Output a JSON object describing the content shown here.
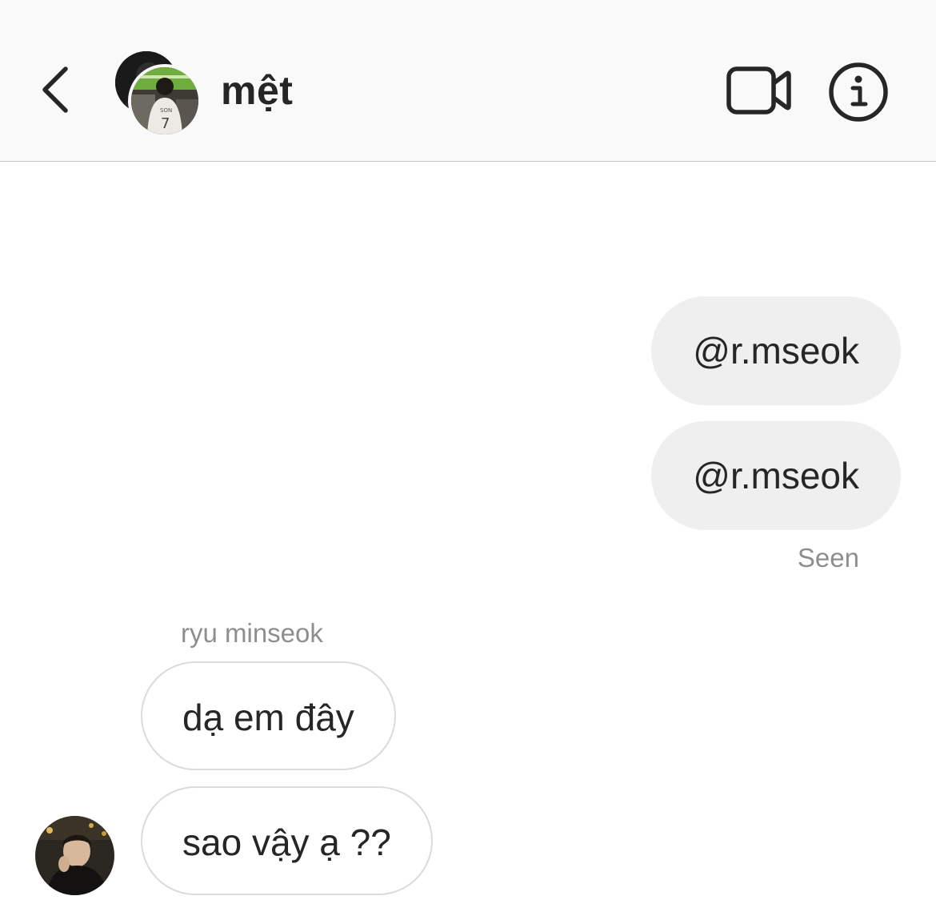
{
  "header": {
    "title": "mệt",
    "back_icon": "chevron-left-icon",
    "video_icon": "video-camera-icon",
    "info_icon": "info-icon"
  },
  "messages": [
    {
      "direction": "out",
      "text": "@r.mseok"
    },
    {
      "direction": "out",
      "text": "@r.mseok"
    },
    {
      "direction": "in",
      "text": "dạ em đây"
    },
    {
      "direction": "in",
      "text": "sao vậy ạ ??"
    }
  ],
  "read_receipt": "Seen",
  "sender": {
    "name": "ryu minseok"
  },
  "colors": {
    "header_bg": "#f9f9f9",
    "outgoing_bubble": "#efefef",
    "incoming_border": "#dbdbdb",
    "meta_text": "#8e8e8e",
    "primary_text": "#262626"
  }
}
